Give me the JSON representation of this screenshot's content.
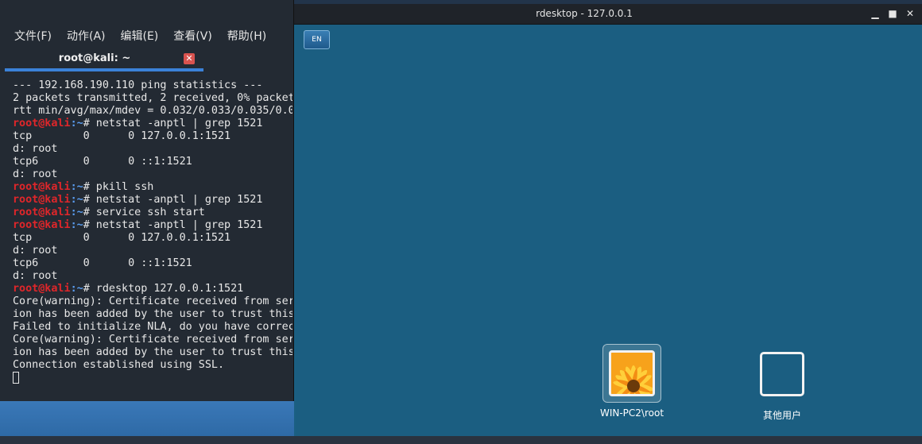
{
  "terminal": {
    "menu": [
      "文件(F)",
      "动作(A)",
      "编辑(E)",
      "查看(V)",
      "帮助(H)"
    ],
    "tab_title": "root@kali: ~",
    "tab_close_icon": "close-icon",
    "prompt_user": "root@kali",
    "prompt_path": ":~",
    "lines": [
      {
        "type": "out",
        "text": "--- 192.168.190.110 ping statistics ---"
      },
      {
        "type": "out",
        "text": "2 packets transmitted, 2 received, 0% packet"
      },
      {
        "type": "out",
        "text": "rtt min/avg/max/mdev = 0.032/0.033/0.035/0.0"
      },
      {
        "type": "cmd",
        "text": "# netstat -anptl | grep 1521"
      },
      {
        "type": "out",
        "text": "tcp        0      0 127.0.0.1:1521"
      },
      {
        "type": "out",
        "text": "d: root"
      },
      {
        "type": "out",
        "text": "tcp6       0      0 ::1:1521"
      },
      {
        "type": "out",
        "text": "d: root"
      },
      {
        "type": "cmd",
        "text": "# pkill ssh"
      },
      {
        "type": "cmd",
        "text": "# netstat -anptl | grep 1521"
      },
      {
        "type": "cmd",
        "text": "# service ssh start"
      },
      {
        "type": "cmd",
        "text": "# netstat -anptl | grep 1521"
      },
      {
        "type": "out",
        "text": "tcp        0      0 127.0.0.1:1521"
      },
      {
        "type": "out",
        "text": "d: root"
      },
      {
        "type": "out",
        "text": "tcp6       0      0 ::1:1521"
      },
      {
        "type": "out",
        "text": "d: root"
      },
      {
        "type": "cmd",
        "text": "# rdesktop 127.0.0.1:1521"
      },
      {
        "type": "out",
        "text": "Core(warning): Certificate received from ser"
      },
      {
        "type": "out",
        "text": "ion has been added by the user to trust this"
      },
      {
        "type": "out",
        "text": "Failed to initialize NLA, do you have correc"
      },
      {
        "type": "out",
        "text": "Core(warning): Certificate received from ser"
      },
      {
        "type": "out",
        "text": "ion has been added by the user to trust this"
      },
      {
        "type": "out",
        "text": "Connection established using SSL."
      }
    ]
  },
  "rdesktop": {
    "title": "rdesktop - 127.0.0.1",
    "controls": {
      "minimize": "▁",
      "maximize": "■",
      "close": "✕"
    },
    "lang_button": "EN",
    "users": [
      {
        "label": "WIN-PC2\\root",
        "icon": "flower-avatar-icon"
      },
      {
        "label": "其他用户",
        "icon": "blank-avatar-icon"
      }
    ]
  },
  "colors": {
    "prompt_user": "#e0262a",
    "prompt_path": "#5a9df0",
    "terminal_bg": "#232a33",
    "rdesktop_bg": "#1b5e81",
    "tab_underline": "#3b82d8"
  }
}
